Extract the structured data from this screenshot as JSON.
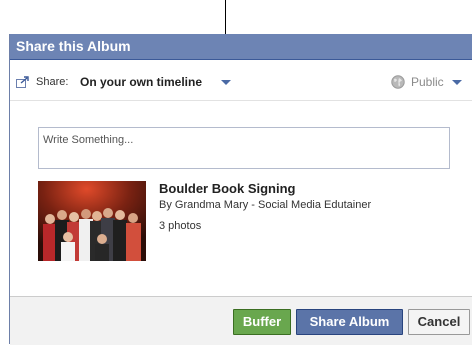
{
  "dialog": {
    "title": "Share this Album"
  },
  "share": {
    "label": "Share:",
    "value": "On your own timeline",
    "audience": "Public"
  },
  "composer": {
    "placeholder": "Write Something..."
  },
  "album": {
    "title": "Boulder Book Signing",
    "byline": "By Grandma Mary - Social Media Edutainer",
    "count": "3 photos"
  },
  "buttons": {
    "buffer": "Buffer",
    "share": "Share Album",
    "cancel": "Cancel"
  },
  "colors": {
    "header": "#6d84b4",
    "buffer": "#69a74e",
    "share": "#5b74a8"
  }
}
